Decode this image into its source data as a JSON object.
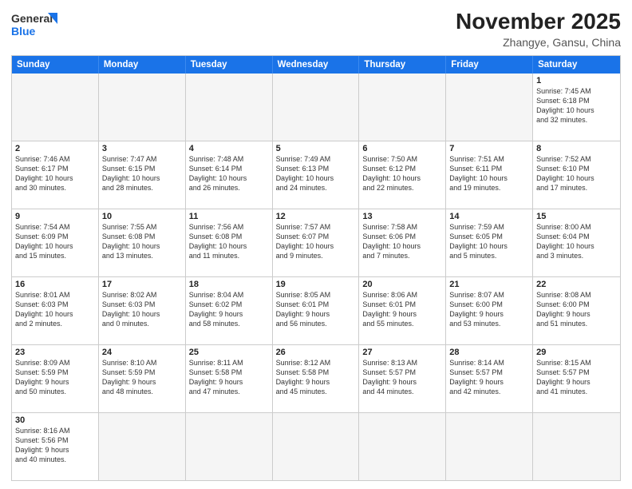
{
  "header": {
    "logo_line1": "General",
    "logo_line2": "Blue",
    "month_title": "November 2025",
    "location": "Zhangye, Gansu, China"
  },
  "weekdays": [
    "Sunday",
    "Monday",
    "Tuesday",
    "Wednesday",
    "Thursday",
    "Friday",
    "Saturday"
  ],
  "rows": [
    [
      {
        "day": "",
        "info": ""
      },
      {
        "day": "",
        "info": ""
      },
      {
        "day": "",
        "info": ""
      },
      {
        "day": "",
        "info": ""
      },
      {
        "day": "",
        "info": ""
      },
      {
        "day": "",
        "info": ""
      },
      {
        "day": "1",
        "info": "Sunrise: 7:45 AM\nSunset: 6:18 PM\nDaylight: 10 hours\nand 32 minutes."
      }
    ],
    [
      {
        "day": "2",
        "info": "Sunrise: 7:46 AM\nSunset: 6:17 PM\nDaylight: 10 hours\nand 30 minutes."
      },
      {
        "day": "3",
        "info": "Sunrise: 7:47 AM\nSunset: 6:15 PM\nDaylight: 10 hours\nand 28 minutes."
      },
      {
        "day": "4",
        "info": "Sunrise: 7:48 AM\nSunset: 6:14 PM\nDaylight: 10 hours\nand 26 minutes."
      },
      {
        "day": "5",
        "info": "Sunrise: 7:49 AM\nSunset: 6:13 PM\nDaylight: 10 hours\nand 24 minutes."
      },
      {
        "day": "6",
        "info": "Sunrise: 7:50 AM\nSunset: 6:12 PM\nDaylight: 10 hours\nand 22 minutes."
      },
      {
        "day": "7",
        "info": "Sunrise: 7:51 AM\nSunset: 6:11 PM\nDaylight: 10 hours\nand 19 minutes."
      },
      {
        "day": "8",
        "info": "Sunrise: 7:52 AM\nSunset: 6:10 PM\nDaylight: 10 hours\nand 17 minutes."
      }
    ],
    [
      {
        "day": "9",
        "info": "Sunrise: 7:54 AM\nSunset: 6:09 PM\nDaylight: 10 hours\nand 15 minutes."
      },
      {
        "day": "10",
        "info": "Sunrise: 7:55 AM\nSunset: 6:08 PM\nDaylight: 10 hours\nand 13 minutes."
      },
      {
        "day": "11",
        "info": "Sunrise: 7:56 AM\nSunset: 6:08 PM\nDaylight: 10 hours\nand 11 minutes."
      },
      {
        "day": "12",
        "info": "Sunrise: 7:57 AM\nSunset: 6:07 PM\nDaylight: 10 hours\nand 9 minutes."
      },
      {
        "day": "13",
        "info": "Sunrise: 7:58 AM\nSunset: 6:06 PM\nDaylight: 10 hours\nand 7 minutes."
      },
      {
        "day": "14",
        "info": "Sunrise: 7:59 AM\nSunset: 6:05 PM\nDaylight: 10 hours\nand 5 minutes."
      },
      {
        "day": "15",
        "info": "Sunrise: 8:00 AM\nSunset: 6:04 PM\nDaylight: 10 hours\nand 3 minutes."
      }
    ],
    [
      {
        "day": "16",
        "info": "Sunrise: 8:01 AM\nSunset: 6:03 PM\nDaylight: 10 hours\nand 2 minutes."
      },
      {
        "day": "17",
        "info": "Sunrise: 8:02 AM\nSunset: 6:03 PM\nDaylight: 10 hours\nand 0 minutes."
      },
      {
        "day": "18",
        "info": "Sunrise: 8:04 AM\nSunset: 6:02 PM\nDaylight: 9 hours\nand 58 minutes."
      },
      {
        "day": "19",
        "info": "Sunrise: 8:05 AM\nSunset: 6:01 PM\nDaylight: 9 hours\nand 56 minutes."
      },
      {
        "day": "20",
        "info": "Sunrise: 8:06 AM\nSunset: 6:01 PM\nDaylight: 9 hours\nand 55 minutes."
      },
      {
        "day": "21",
        "info": "Sunrise: 8:07 AM\nSunset: 6:00 PM\nDaylight: 9 hours\nand 53 minutes."
      },
      {
        "day": "22",
        "info": "Sunrise: 8:08 AM\nSunset: 6:00 PM\nDaylight: 9 hours\nand 51 minutes."
      }
    ],
    [
      {
        "day": "23",
        "info": "Sunrise: 8:09 AM\nSunset: 5:59 PM\nDaylight: 9 hours\nand 50 minutes."
      },
      {
        "day": "24",
        "info": "Sunrise: 8:10 AM\nSunset: 5:59 PM\nDaylight: 9 hours\nand 48 minutes."
      },
      {
        "day": "25",
        "info": "Sunrise: 8:11 AM\nSunset: 5:58 PM\nDaylight: 9 hours\nand 47 minutes."
      },
      {
        "day": "26",
        "info": "Sunrise: 8:12 AM\nSunset: 5:58 PM\nDaylight: 9 hours\nand 45 minutes."
      },
      {
        "day": "27",
        "info": "Sunrise: 8:13 AM\nSunset: 5:57 PM\nDaylight: 9 hours\nand 44 minutes."
      },
      {
        "day": "28",
        "info": "Sunrise: 8:14 AM\nSunset: 5:57 PM\nDaylight: 9 hours\nand 42 minutes."
      },
      {
        "day": "29",
        "info": "Sunrise: 8:15 AM\nSunset: 5:57 PM\nDaylight: 9 hours\nand 41 minutes."
      }
    ],
    [
      {
        "day": "30",
        "info": "Sunrise: 8:16 AM\nSunset: 5:56 PM\nDaylight: 9 hours\nand 40 minutes."
      },
      {
        "day": "",
        "info": ""
      },
      {
        "day": "",
        "info": ""
      },
      {
        "day": "",
        "info": ""
      },
      {
        "day": "",
        "info": ""
      },
      {
        "day": "",
        "info": ""
      },
      {
        "day": "",
        "info": ""
      }
    ]
  ]
}
